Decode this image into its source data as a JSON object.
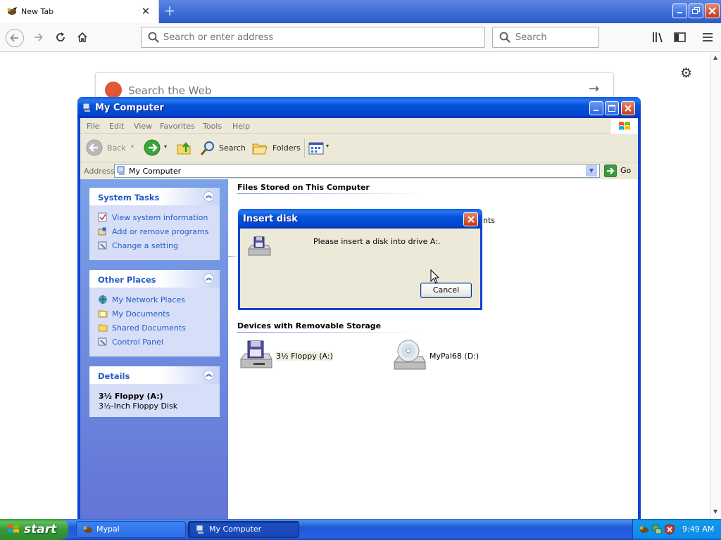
{
  "browser": {
    "tab_title": "New Tab",
    "tab_close": "✕",
    "new_tab": "+",
    "urlbar_placeholder": "Search or enter address",
    "searchbar_placeholder": "Search",
    "ddg_placeholder": "Search the Web"
  },
  "window": {
    "title": "My Computer",
    "menu": [
      "File",
      "Edit",
      "View",
      "Favorites",
      "Tools",
      "Help"
    ],
    "toolbar": {
      "back": "Back",
      "search": "Search",
      "folders": "Folders"
    },
    "address_label": "Address",
    "address_value": "My Computer",
    "go_label": "Go"
  },
  "tasks": {
    "system": {
      "title": "System Tasks",
      "items": [
        "View system information",
        "Add or remove programs",
        "Change a setting"
      ]
    },
    "other": {
      "title": "Other Places",
      "items": [
        "My Network Places",
        "My Documents",
        "Shared Documents",
        "Control Panel"
      ]
    },
    "details": {
      "title": "Details",
      "name": "3½ Floppy (A:)",
      "desc": "3½-Inch Floppy Disk"
    }
  },
  "main": {
    "files_header": "Files Stored on This Computer",
    "files_partial": "nts",
    "devices_header": "Devices with Removable Storage",
    "devices": [
      "3½ Floppy (A:)",
      "MyPal68 (D:)"
    ]
  },
  "dialog": {
    "title": "Insert disk",
    "message": "Please insert a disk into drive A:.",
    "cancel": "Cancel"
  },
  "taskbar": {
    "start": "start",
    "buttons": [
      "Mypal",
      "My Computer"
    ],
    "clock": "9:49 AM"
  }
}
